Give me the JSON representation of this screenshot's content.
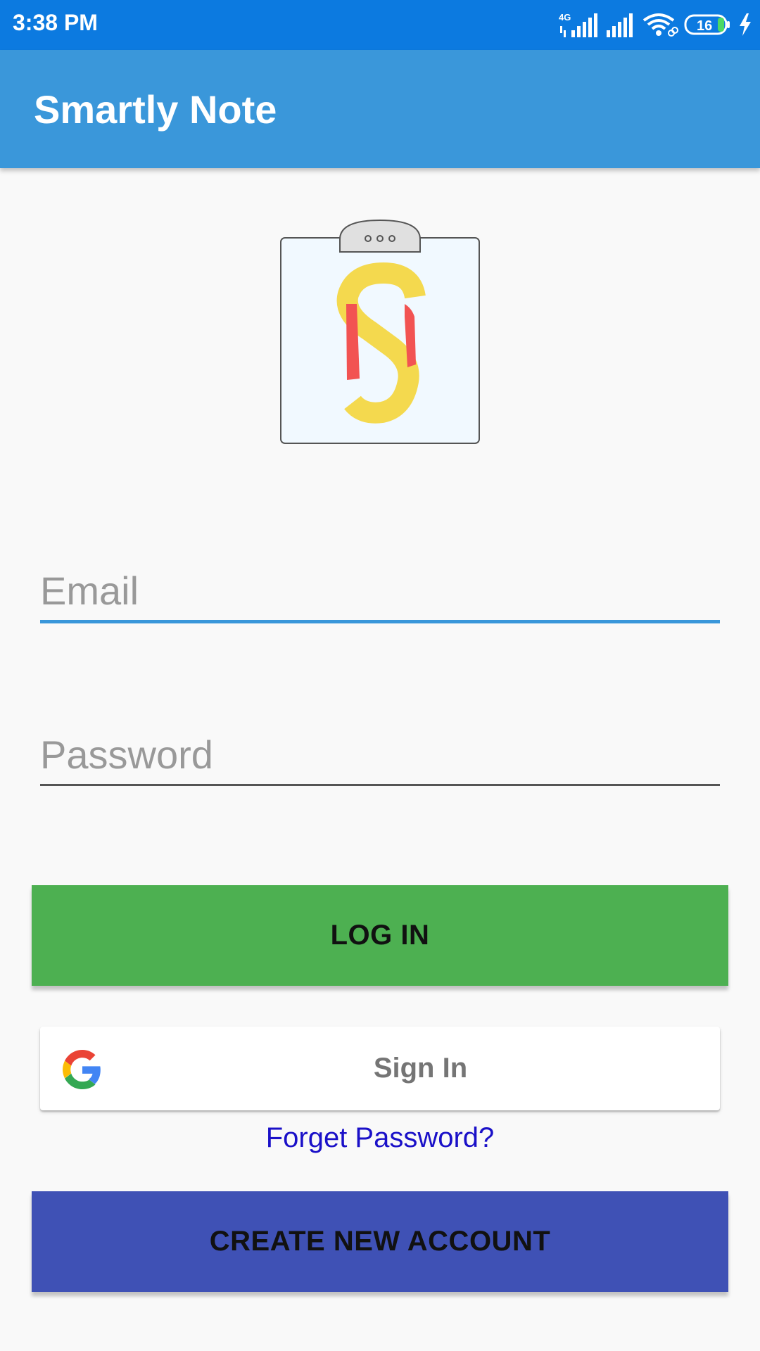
{
  "status_bar": {
    "time": "3:38 PM",
    "network_type": "4G",
    "battery_percent": "16",
    "icons": [
      "signal-4g-icon",
      "signal-icon",
      "wifi-icon",
      "battery-icon",
      "charging-icon"
    ]
  },
  "app_bar": {
    "title": "Smartly Note"
  },
  "logo": {
    "icon": "clipboard-sn-logo"
  },
  "form": {
    "email_placeholder": "Email",
    "password_placeholder": "Password"
  },
  "buttons": {
    "login_label": "LOG IN",
    "google_sign_in_label": "Sign In",
    "forget_password_label": "Forget Password?",
    "create_account_label": "CREATE NEW ACCOUNT"
  },
  "colors": {
    "status_bar": "#0c7ae0",
    "app_bar": "#3a97da",
    "login_button": "#4db051",
    "create_button": "#3f51b5",
    "link": "#1a10c8",
    "logo_yellow": "#f4d94e",
    "logo_red": "#f25352"
  }
}
